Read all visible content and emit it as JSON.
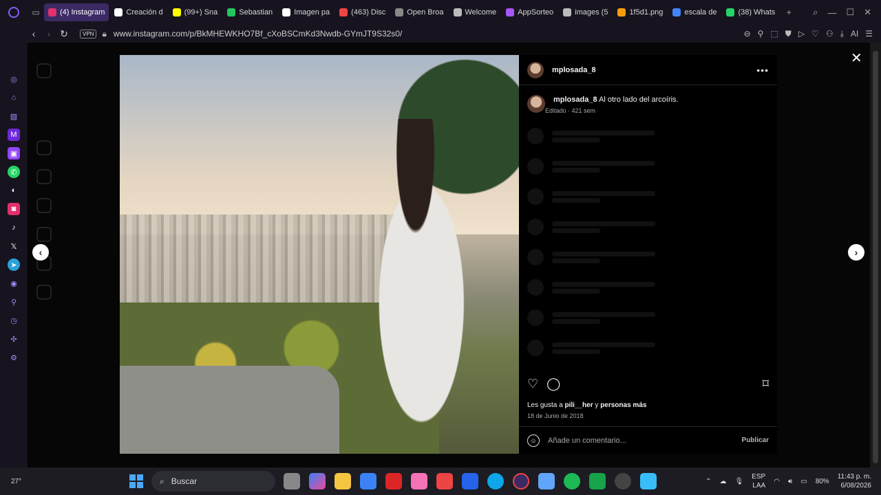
{
  "browser": {
    "tabs": [
      {
        "label": "(4) Instagram",
        "active": true,
        "color": "#e1306c"
      },
      {
        "label": "Creación d",
        "color": "#ffffff"
      },
      {
        "label": "(99+) Sna",
        "color": "#fffc00"
      },
      {
        "label": "Sebastian",
        "color": "#22c55e"
      },
      {
        "label": "Imagen pa",
        "color": "#ffffff"
      },
      {
        "label": "(463) Disc",
        "color": "#ef4444"
      },
      {
        "label": "Open Broa",
        "color": "#888888"
      },
      {
        "label": "Welcome",
        "color": "#bbbbbb"
      },
      {
        "label": "AppSorteo",
        "color": "#a855f7"
      },
      {
        "label": "images (5",
        "color": "#bbbbbb"
      },
      {
        "label": "1f5d1.png",
        "color": "#f59e0b"
      },
      {
        "label": "escala de",
        "color": "#4285f4"
      },
      {
        "label": "(38) Whats",
        "color": "#25d366"
      }
    ],
    "new_tab": "+",
    "vpn": "VPN",
    "url": "www.instagram.com/p/BkMHEWKHO7Bf_cXoBSCmKd3Nwdb-GYmJT9S32s0/",
    "ai_label": "AI"
  },
  "post": {
    "username": "mplosada_8",
    "caption": "Al otro lado del arcoíris.",
    "meta": "Editado · 421 sem",
    "likes_prefix": "Les gusta a ",
    "likes_user": "pili__her",
    "likes_suffix": " y ",
    "likes_more": "personas más",
    "date": "18 de Junio de 2018",
    "comment_placeholder": "Añade un comentario...",
    "publish": "Publicar"
  },
  "taskbar": {
    "weather": "27°",
    "search": "Buscar",
    "lang1": "ESP",
    "lang2": "LAA",
    "battery": "80%",
    "time": "11:43 p. m.",
    "date": "6/08/2026"
  }
}
